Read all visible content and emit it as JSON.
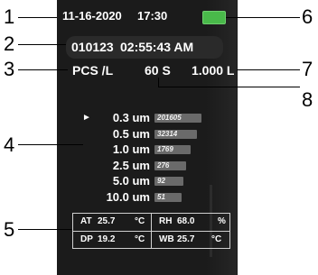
{
  "status_bar": {
    "date": "11-16-2020",
    "time": "17:30"
  },
  "record": {
    "id": "010123",
    "duration": "02:55:43 AM"
  },
  "units_row": {
    "unit": "PCS /L",
    "sample_time": "60 S",
    "volume": "1.000 L"
  },
  "particles": [
    {
      "size": "0.3 um",
      "count": "201605",
      "count_value": 201605,
      "selected": true
    },
    {
      "size": "0.5 um",
      "count": "32314",
      "count_value": 32314,
      "selected": false
    },
    {
      "size": "1.0 um",
      "count": "1769",
      "count_value": 1769,
      "selected": false
    },
    {
      "size": "2.5 um",
      "count": "276",
      "count_value": 276,
      "selected": false
    },
    {
      "size": "5.0 um",
      "count": "92",
      "count_value": 92,
      "selected": false
    },
    {
      "size": "10.0 um",
      "count": "51",
      "count_value": 51,
      "selected": false
    }
  ],
  "selector_glyph": "►",
  "environment": {
    "at": {
      "label": "AT",
      "value": "25.7",
      "unit": "°C"
    },
    "rh": {
      "label": "RH",
      "value": "68.0",
      "unit": "%"
    },
    "dp": {
      "label": "DP",
      "value": "19.2",
      "unit": "°C"
    },
    "wb": {
      "label": "WB",
      "value": "25.7",
      "unit": "°C"
    }
  },
  "callouts": [
    "1",
    "2",
    "3",
    "4",
    "5",
    "6",
    "7",
    "8"
  ],
  "colors": {
    "screen": "#1b1b1b",
    "battery": "#49b94a",
    "bar": "#6a6a6a",
    "callout": "#000000"
  }
}
